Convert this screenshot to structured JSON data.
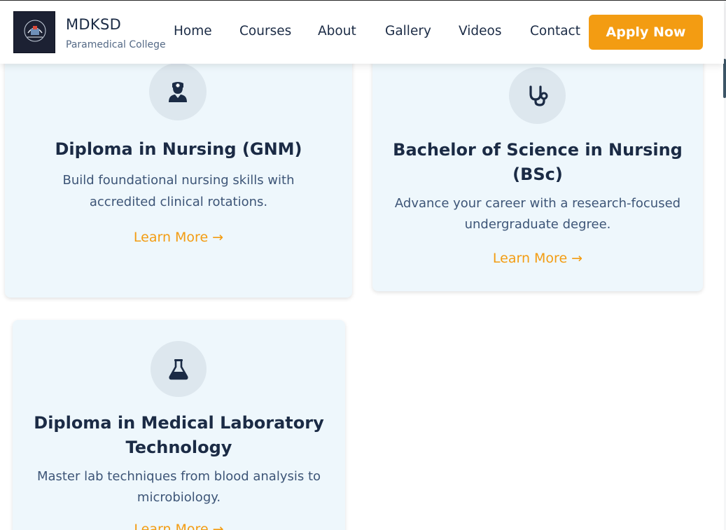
{
  "header": {
    "brand_name": "MDKSD",
    "brand_subtitle": "Paramedical College",
    "logo_text": "MDKSD",
    "nav": [
      "Home",
      "Courses",
      "About",
      "Gallery",
      "Videos",
      "Contact"
    ],
    "apply_label": "Apply Now"
  },
  "courses": [
    {
      "icon": "nurse-icon",
      "title": "Diploma in Nursing (GNM)",
      "description_lines": [
        "Build foundational nursing skills with",
        "accredited clinical rotations."
      ],
      "link": "Learn More →"
    },
    {
      "icon": "stethoscope-icon",
      "title_lines": [
        "Bachelor of Science in Nursing",
        "(BSc)"
      ],
      "description_lines": [
        "Advance your career with a research-focused",
        "undergraduate degree."
      ],
      "link": "Learn More →"
    },
    {
      "icon": "flask-icon",
      "title_lines": [
        "Diploma in Medical Laboratory",
        "Technology"
      ],
      "description_lines": [
        "Master lab techniques from blood analysis to",
        "microbiology."
      ],
      "link": "Learn More →"
    }
  ],
  "colors": {
    "accent": "#f39c12",
    "navy": "#1b2b45",
    "card_bg": "#eef7fc"
  }
}
